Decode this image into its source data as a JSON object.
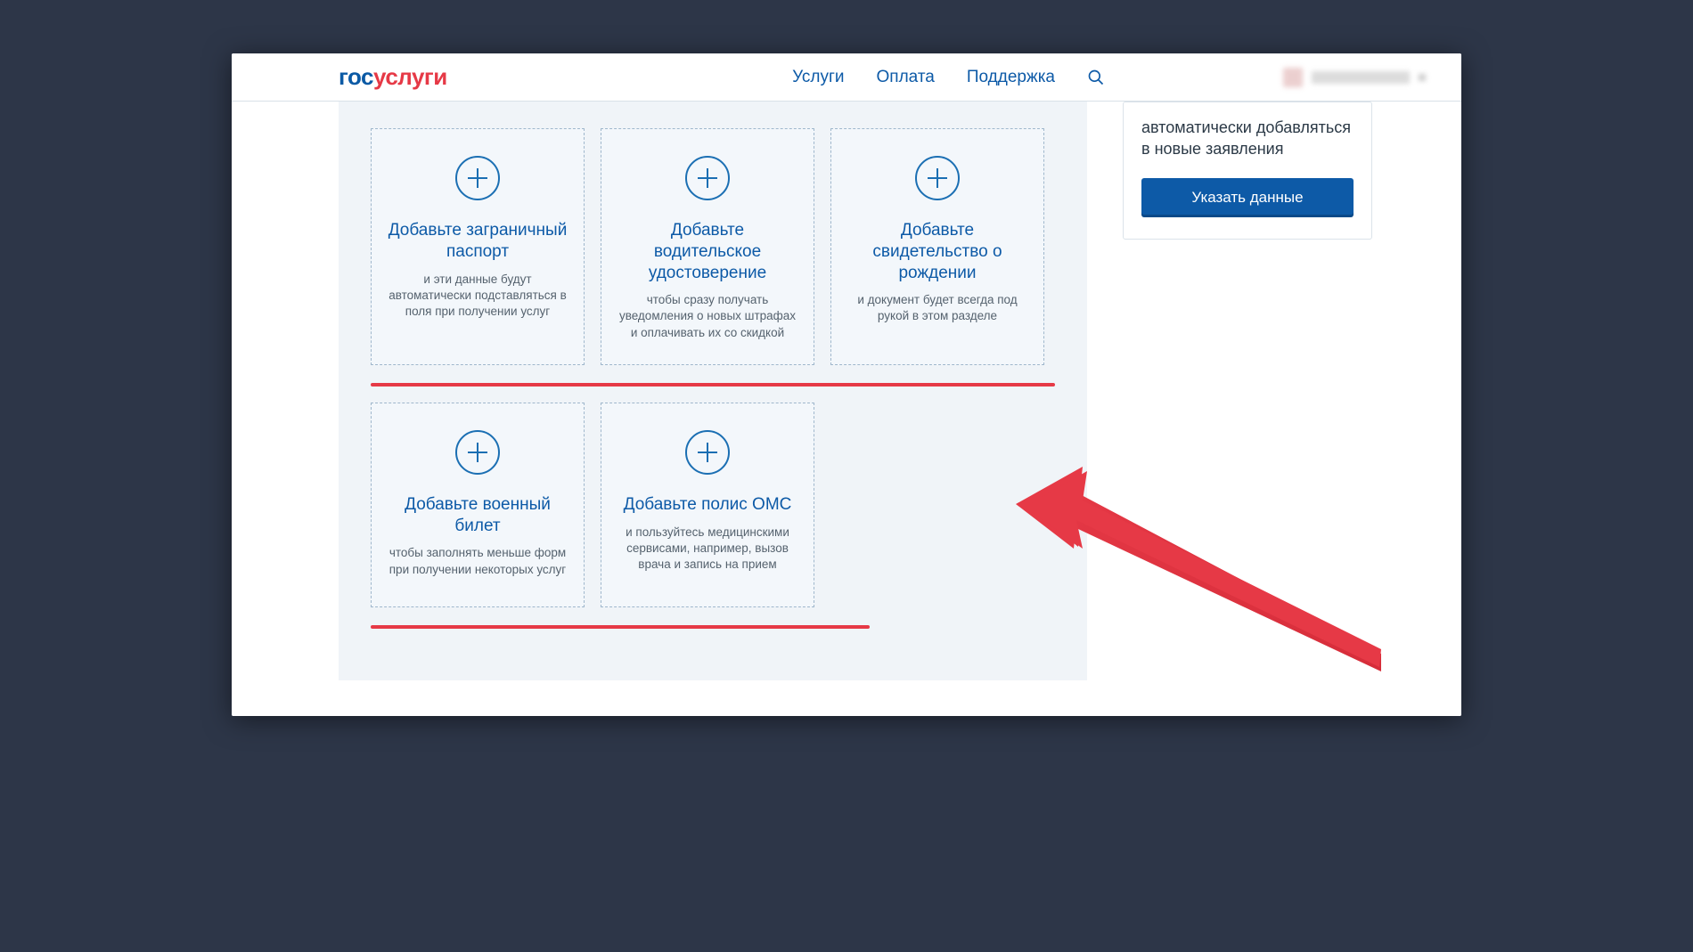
{
  "header": {
    "logo_gos": "гос",
    "logo_uslugi": "услуги",
    "nav": {
      "services": "Услуги",
      "payment": "Оплата",
      "support": "Поддержка"
    }
  },
  "cards": {
    "row1": [
      {
        "title": "Добавьте заграничный паспорт",
        "desc": "и эти данные будут автоматически подставляться в поля при получении услуг"
      },
      {
        "title": "Добавьте водительское удостоверение",
        "desc": "чтобы сразу получать уведомления о новых штрафах и оплачивать их со скидкой"
      },
      {
        "title": "Добавьте свидетельство о рождении",
        "desc": "и документ будет всегда под рукой в этом разделе"
      }
    ],
    "row2": [
      {
        "title": "Добавьте военный билет",
        "desc": "чтобы заполнять меньше форм при получении некоторых услуг"
      },
      {
        "title": "Добавьте полис ОМС",
        "desc": "и пользуйтесь медицинскими сервисами, например, вызов врача и запись на прием"
      }
    ]
  },
  "side": {
    "text": "автоматически добавляться в новые заявления",
    "button": "Указать данные"
  }
}
